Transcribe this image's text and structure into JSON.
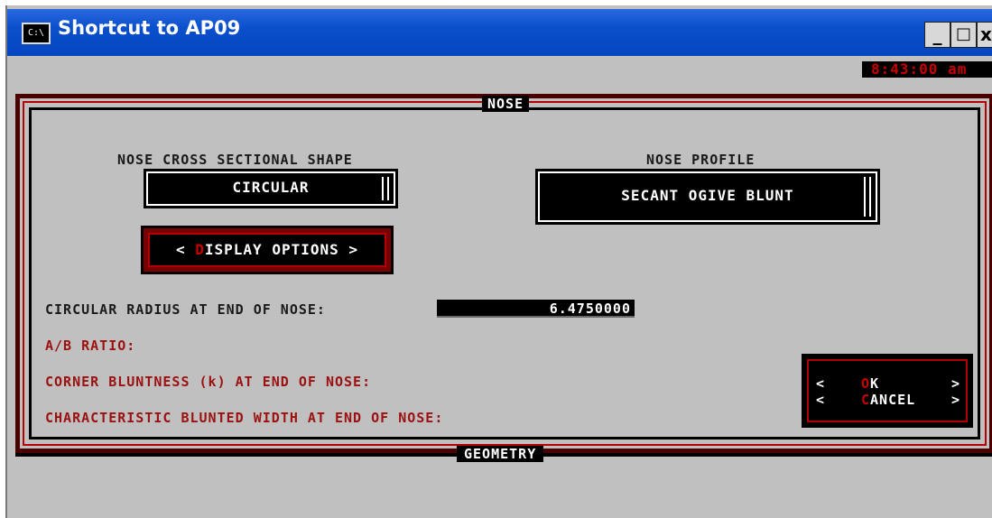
{
  "window": {
    "title": "Shortcut to AP09",
    "icon_text": "C:\\",
    "icon": "console-icon",
    "minimize_label": "_",
    "maximize_label": "□",
    "close_label": "x"
  },
  "clock": "8:43:00 am",
  "nose_section": {
    "title": "NOSE",
    "cross_section_label": "NOSE CROSS SECTIONAL SHAPE",
    "cross_section_value": "CIRCULAR",
    "profile_label": "NOSE PROFILE",
    "profile_value": "SECANT OGIVE BLUNT",
    "display_options": {
      "prefix": "< ",
      "hotkey": "D",
      "rest": "ISPLAY OPTIONS >"
    },
    "fields": {
      "radius_label": "CIRCULAR RADIUS AT END OF NOSE:",
      "radius_value": "6.4750000",
      "ab_ratio_label": "A/B RATIO:",
      "corner_label": "CORNER BLUNTNESS (k) AT END OF NOSE:",
      "blunted_width_label": "CHARACTERISTIC BLUNTED WIDTH AT END OF NOSE:"
    },
    "dialog_buttons": {
      "ok_hotkey": "O",
      "ok_rest": "K",
      "cancel_hotkey": "C",
      "cancel_rest": "ANCEL",
      "left_bracket": "<",
      "right_bracket": ">"
    }
  },
  "geometry_section": {
    "title": "GEOMETRY"
  },
  "colors": {
    "titlebar": "#0a4fcc",
    "background": "#c0c0c0",
    "frame_dark_red": "#4a0000",
    "frame_red": "#b40000",
    "label_red": "#9c1010",
    "hotkey_red": "#c80000"
  }
}
